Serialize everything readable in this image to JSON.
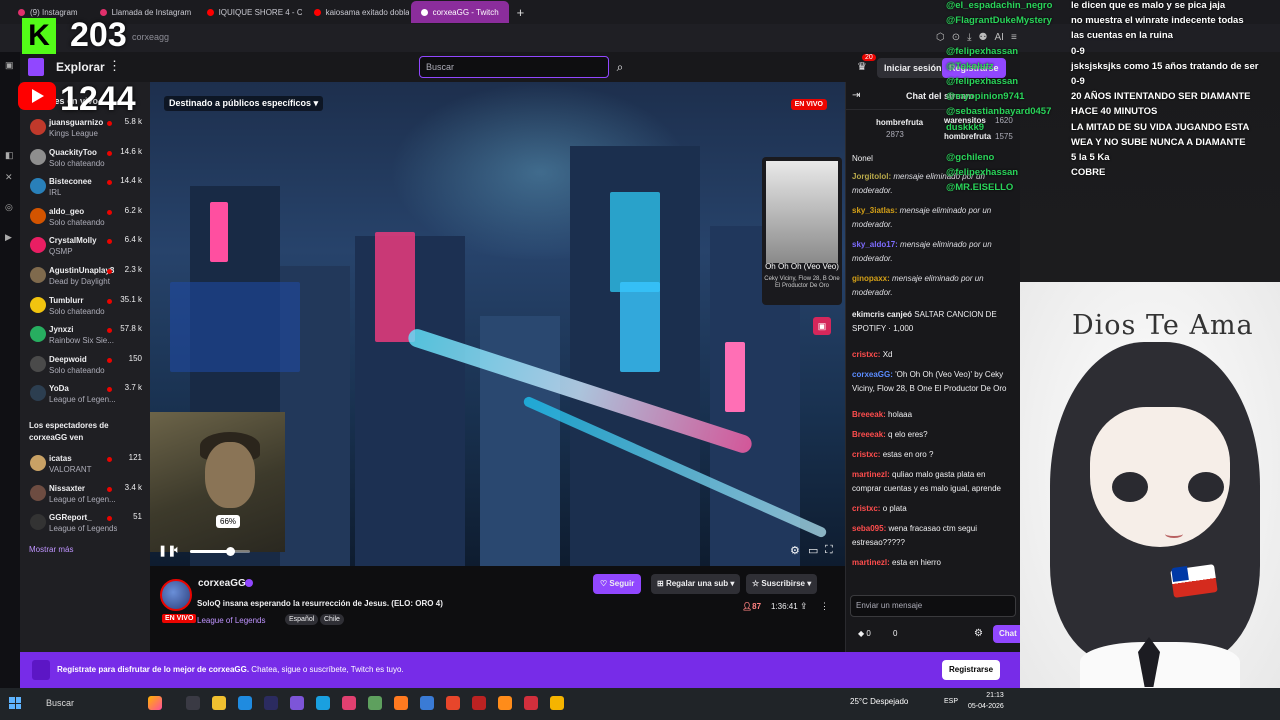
{
  "browser": {
    "tabs": [
      {
        "label": "(9) Instagram",
        "color": "#e1306c"
      },
      {
        "label": "Llamada de Instagram",
        "color": "#e1306c"
      },
      {
        "label": "IQUIQUE SHORE 4 - Capí",
        "color": "#ff0000"
      },
      {
        "label": "kaiosama exitado doblaje",
        "color": "#ff0000"
      },
      {
        "label": "corxeaGG - Twitch",
        "color": "#ffffff",
        "active": true
      }
    ],
    "url": "corxeagg"
  },
  "stats": {
    "kick_count": "203",
    "youtube_count": "1244"
  },
  "topbar": {
    "explore": "Explorar",
    "search_placeholder": "Buscar",
    "notifications_badge": "20",
    "login": "Iniciar sesión",
    "signup": "Registrarse"
  },
  "sidebar": {
    "header": "Canales en vivo",
    "channels": [
      {
        "name": "juansguarnizo",
        "game": "Kings League",
        "viewers": "5.8 k",
        "color": "#c0392b"
      },
      {
        "name": "QuackityToo",
        "game": "Solo chateando",
        "viewers": "14.6 k",
        "color": "#8e8e8e"
      },
      {
        "name": "Bisteconee",
        "game": "IRL",
        "viewers": "14.4 k",
        "color": "#2980b9"
      },
      {
        "name": "aldo_geo",
        "game": "Solo chateando",
        "viewers": "6.2 k",
        "color": "#d35400"
      },
      {
        "name": "CrystalMolly",
        "game": "QSMP",
        "viewers": "6.4 k",
        "color": "#e91e63"
      },
      {
        "name": "AgustinUnaplay8",
        "game": "Dead by Daylight",
        "viewers": "2.3 k",
        "color": "#7f6a4d"
      },
      {
        "name": "Tumblurr",
        "game": "Solo chateando",
        "viewers": "35.1 k",
        "color": "#f1c40f"
      },
      {
        "name": "Jynxzi",
        "game": "Rainbow Six Sie...",
        "viewers": "57.8 k",
        "color": "#27ae60"
      },
      {
        "name": "Deepwoid",
        "game": "Solo chateando",
        "viewers": "150",
        "color": "#4a4a4a"
      },
      {
        "name": "YoDa",
        "game": "League of Legen...",
        "viewers": "3.7 k",
        "color": "#2c3e50"
      }
    ],
    "viewers_section": "Los espectadores de corxeaGG ven",
    "viewer_channels": [
      {
        "name": "icatas",
        "game": "VALORANT",
        "viewers": "121",
        "color": "#c8a165"
      },
      {
        "name": "Nissaxter",
        "game": "League of Legen...",
        "viewers": "3.4 k",
        "color": "#6d4c41"
      },
      {
        "name": "GGReport_",
        "game": "League of Legends",
        "viewers": "51",
        "color": "#333333"
      }
    ],
    "show_more": "Mostrar más"
  },
  "video": {
    "audience_label": "Destinado a públicos específicos",
    "live_badge": "EN VIVO",
    "volume_tooltip": "66%",
    "volume_level": 0.66,
    "now_playing": {
      "title": "Oh Oh Oh (Veo Veo)",
      "artists": "Ceky Viciny, Flow 28, B One El Productor De Oro"
    }
  },
  "stream": {
    "streamer": "corxeaGG",
    "live": "EN VIVO",
    "title": "SoloQ insana esperando la resurrección de Jesus. (ELO: ORO 4)",
    "game": "League of Legends",
    "tags": [
      "Español",
      "Chile"
    ],
    "follow": "Seguir",
    "gift": "Regalar una sub",
    "subscribe": "Suscribirse",
    "viewers": "87",
    "uptime": "1:36:41"
  },
  "chat": {
    "title": "Chat del stream",
    "leaderboard": [
      {
        "name": "hombrefruta",
        "value": "2873"
      },
      {
        "name": "warensitos",
        "value": "1620"
      },
      {
        "name": "hombrefruta",
        "value": "1575"
      }
    ],
    "messages": [
      {
        "user": "",
        "text": "Nonel",
        "color": "#efeff1"
      },
      {
        "user": "Jorgitolol:",
        "text": "mensaje eliminado por un moderador.",
        "color": "#b8a94a",
        "deleted": true
      },
      {
        "user": "sky_3iatlas:",
        "text": "mensaje eliminado por un moderador.",
        "color": "#d4a017",
        "deleted": true
      },
      {
        "user": "sky_aldo17:",
        "text": "mensaje eliminado por un moderador.",
        "color": "#7d6cff",
        "deleted": true
      },
      {
        "user": "ginopaxx:",
        "text": "mensaje eliminado por un moderador.",
        "color": "#d4a017",
        "deleted": true
      },
      {
        "user": "ekimcris canjeó",
        "text": "SALTAR CANCION DE SPOTIFY · 1,000",
        "color": "#efeff1"
      },
      {
        "user": "cristxc:",
        "text": "Xd",
        "color": "#ff4d4d"
      },
      {
        "user": "corxeaGG:",
        "text": "'Oh Oh Oh (Veo Veo)' by Ceky Viciny, Flow 28, B One El Productor De Oro",
        "color": "#5b8cff"
      },
      {
        "user": "Breeeak:",
        "text": "holaaa",
        "color": "#ff4d4d"
      },
      {
        "user": "Breeeak:",
        "text": "q elo eres?",
        "color": "#ff4d4d"
      },
      {
        "user": "cristxc:",
        "text": "estas en oro ?",
        "color": "#ff4d4d"
      },
      {
        "user": "martinezl:",
        "text": "quliao malo gasta plata en comprar cuentas y es malo igual, aprende",
        "color": "#ff4d4d"
      },
      {
        "user": "cristxc:",
        "text": "o plata",
        "color": "#ff4d4d"
      },
      {
        "user": "seba095:",
        "text": "wena fracasao ctm segui estresao?????",
        "color": "#ff4d4d"
      },
      {
        "user": "martinezl:",
        "text": "esta en hierro",
        "color": "#ff4d4d"
      }
    ],
    "input_placeholder": "Enviar un mensaje",
    "points": "0",
    "bits": "0",
    "send": "Chat"
  },
  "ticker": [
    {
      "user": "@el_espadachin_negro",
      "text": "le dicen que es malo y se pica jaja"
    },
    {
      "user": "@FlagrantDukeMystery",
      "text": "no muestra el winrate indecente todas"
    },
    {
      "user": "",
      "text": "las cuentas en la ruina"
    },
    {
      "user": "@felipexhassan",
      "text": "0-9"
    },
    {
      "user": "@Tokolutz",
      "text": "jsksjsksjks como 15 años tratando de ser"
    },
    {
      "user": "@felipexhassan",
      "text": "0-9"
    },
    {
      "user": "@myopinion9741",
      "text": "20 AÑOS INTENTANDO SER DIAMANTE"
    },
    {
      "user": "@sebastianbayard0457",
      "text": "HACE 40 MINUTOS"
    },
    {
      "user": "duskkk9",
      "text": "LA MITAD DE SU VIDA JUGANDO ESTA"
    },
    {
      "user": "",
      "text": "WEA Y NO SUBE NUNCA A DIAMANTE"
    },
    {
      "user": "@gchileno",
      "text": "5 la 5 Ka"
    },
    {
      "user": "@felipexhassan",
      "text": "COBRE"
    },
    {
      "user": "@MR.EISELLO",
      "text": ""
    }
  ],
  "overlay": {
    "watermark": "Dios Te Ama"
  },
  "banner": {
    "text_bold": "Regístrate para disfrutar de lo mejor de corxeaGG.",
    "text": "Chatea, sigue o suscríbete, Twitch es tuyo.",
    "button": "Registrarse"
  },
  "taskbar": {
    "search": "Buscar",
    "weather": "25°C Despejado",
    "language": "ESP",
    "time": "21:13",
    "date": "05-04-2026"
  }
}
